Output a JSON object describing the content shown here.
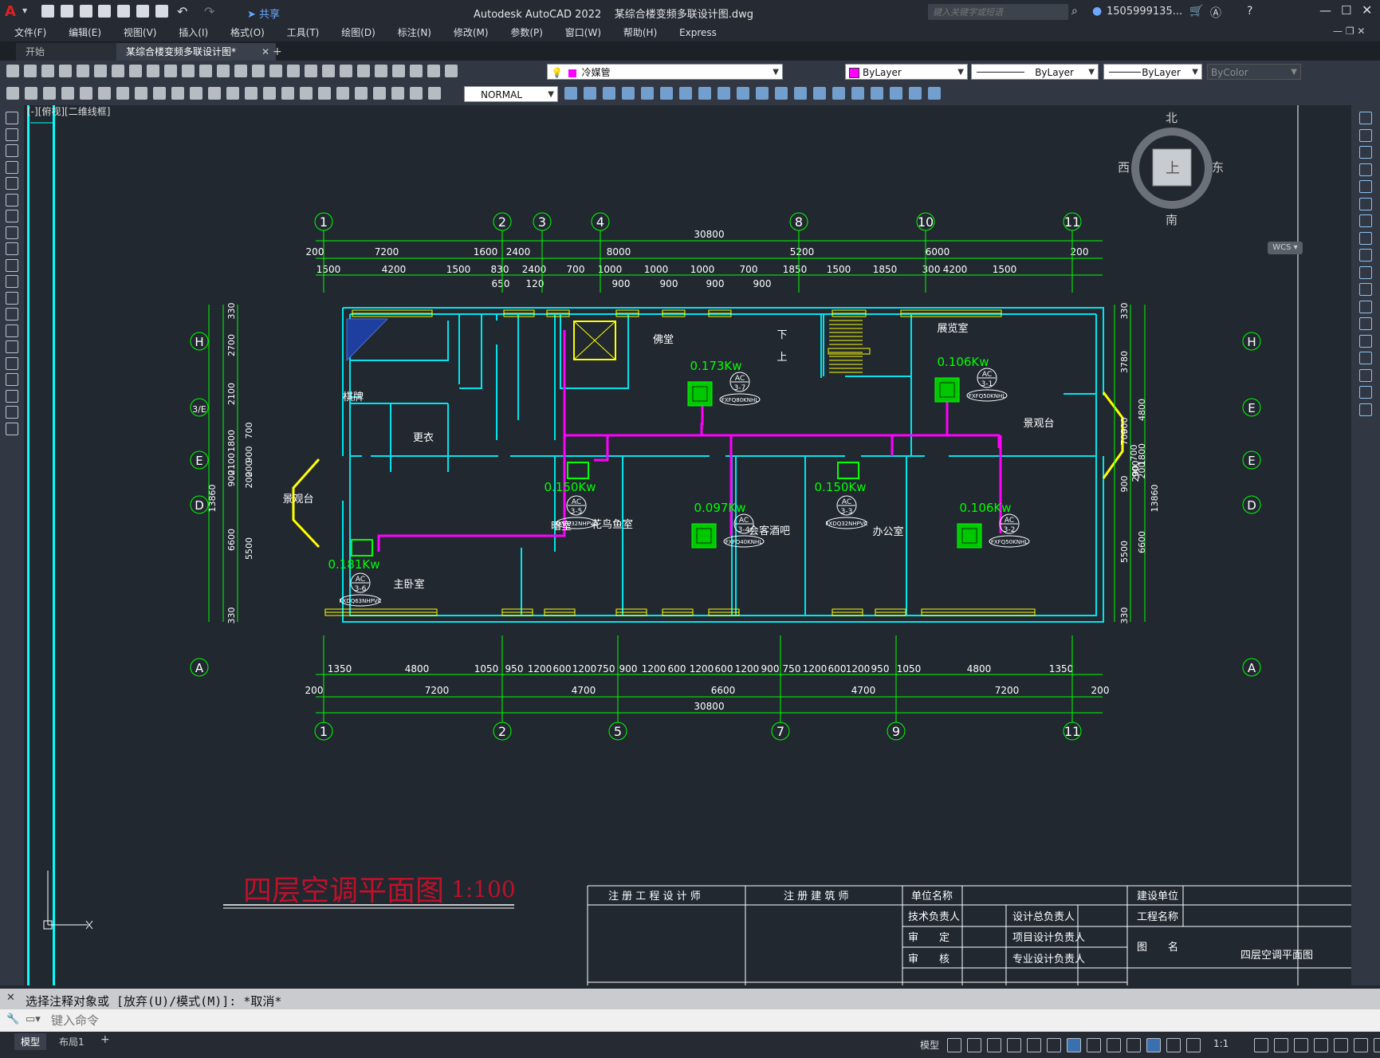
{
  "title": {
    "app_name": "Autodesk AutoCAD 2022",
    "file_name": "某综合楼变频多联设计图.dwg",
    "search_placeholder": "键入关键字或短语",
    "user": "1505999135...",
    "share": "共享"
  },
  "menus": [
    "文件(F)",
    "编辑(E)",
    "视图(V)",
    "插入(I)",
    "格式(O)",
    "工具(T)",
    "绘图(D)",
    "标注(N)",
    "修改(M)",
    "参数(P)",
    "窗口(W)",
    "帮助(H)",
    "Express"
  ],
  "tabs": {
    "start": "开始",
    "active": "某综合楼变频多联设计图*"
  },
  "toolbar": {
    "layer": "冷媒管",
    "layer_color": "#ff00ff",
    "color_combo": "ByLayer",
    "linetype_combo": "ByLayer",
    "lineweight_combo": "ByLayer",
    "plotstyle_combo": "ByColor",
    "dimstyle_combo": "NORMAL"
  },
  "viewport_label": "[-][俯视][二维线框]",
  "viewcube": {
    "north": "北",
    "south": "南",
    "east": "东",
    "west": "西",
    "top": "上",
    "wcs": "WCS"
  },
  "drawing": {
    "title": "四层空调平面图",
    "scale": "1:100",
    "grid_top": [
      "1",
      "2",
      "3",
      "4",
      "8",
      "10",
      "11"
    ],
    "grid_bottom": [
      "1",
      "2",
      "5",
      "7",
      "9",
      "11"
    ],
    "grid_side": [
      "H",
      "3/E",
      "E",
      "D",
      "A"
    ],
    "dims_top_total": "30800",
    "dims_top_row1": [
      "200",
      "7200",
      "1600",
      "2400",
      "8000",
      "5200",
      "6000",
      "200"
    ],
    "dims_top_row2": [
      "1500",
      "4200",
      "1500",
      "830",
      "2400",
      "700",
      "1000",
      "1000",
      "1000",
      "700",
      "1850",
      "1500",
      "1850",
      "300",
      "4200",
      "1500"
    ],
    "dims_top_row3": [
      "650",
      "120",
      "900",
      "900",
      "900",
      "900"
    ],
    "dims_bottom_row1": [
      "1350",
      "4800",
      "1050",
      "950",
      "1200",
      "600",
      "1200",
      "750",
      "900",
      "1200",
      "600",
      "1200",
      "600",
      "1200",
      "900",
      "750",
      "1200",
      "600",
      "1200",
      "950",
      "1050",
      "4800",
      "1350"
    ],
    "dims_bottom_row2": [
      "200",
      "7200",
      "4700",
      "6600",
      "4700",
      "7200",
      "200"
    ],
    "dims_bottom_total": "30800",
    "dims_left": [
      "330",
      "2700",
      "2100",
      "1800",
      "900",
      "2100",
      "6600",
      "5500",
      "330",
      "13860",
      "700",
      "900",
      "200",
      "200"
    ],
    "dims_right": [
      "330",
      "3780",
      "4800",
      "900",
      "700",
      "1800",
      "200",
      "900",
      "6600",
      "5500",
      "330",
      "13860",
      "900",
      "700",
      "200"
    ],
    "rooms": [
      "佛堂",
      "展览室",
      "景观台",
      "棋牌",
      "更衣",
      "景观台",
      "暗室",
      "花鸟鱼室",
      "会客酒吧",
      "办公室",
      "主卧室",
      "下",
      "上"
    ],
    "units": [
      {
        "power": "0.173Kw",
        "tag": "AC",
        "code": "3-7",
        "model": "FXFQ80KNHL"
      },
      {
        "power": "0.106Kw",
        "tag": "AC",
        "code": "3-1",
        "model": "FXFQ50KNHL"
      },
      {
        "power": "0.150Kw",
        "tag": "AC",
        "code": "3-5",
        "model": "FXDQ32NHPVC"
      },
      {
        "power": "0.097Kw",
        "tag": "AC",
        "code": "3-4",
        "model": "FXFQ40KNHL"
      },
      {
        "power": "0.150Kw",
        "tag": "AC",
        "code": "3-3",
        "model": "FXDQ32NHPVC"
      },
      {
        "power": "0.106Kw",
        "tag": "AC",
        "code": "3-2",
        "model": "FXFQ50KNHL"
      },
      {
        "power": "0.181Kw",
        "tag": "AC",
        "code": "3-6",
        "model": "FXDQ63NHPVC"
      }
    ],
    "title_block": {
      "reg_engineer": "注 册 工 程 设 计 师",
      "reg_architect": "注 册 建 筑 师",
      "unit_name": "单位名称",
      "tech_lead": "技术负责人",
      "review": "审　　定",
      "check": "审　　核",
      "design_lead": "设计总负责人",
      "project_lead": "项目设计负责人",
      "discipline_lead": "专业设计负责人",
      "client": "建设单位",
      "project_name": "工程名称",
      "drawing_name_label": "图　　名",
      "drawing_name": "四层空调平面图"
    }
  },
  "command": {
    "history": "选择注释对象或 [放弃(U)/模式(M)]: *取消*",
    "placeholder": "键入命令"
  },
  "status": {
    "model_tab": "模型",
    "layout_tab": "布局1",
    "model_btn": "模型",
    "scale": "1:1"
  }
}
